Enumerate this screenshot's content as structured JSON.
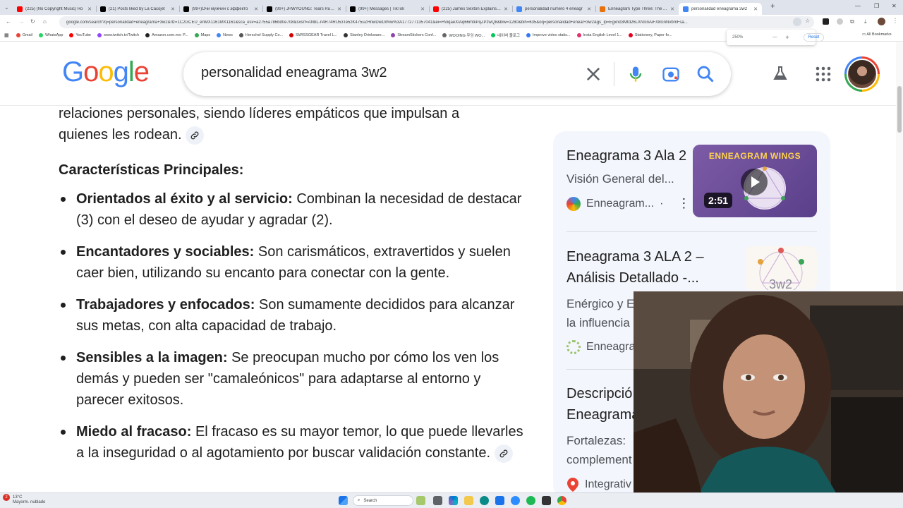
{
  "browser": {
    "tabs": [
      {
        "title": "(225) (No Copyright Music) Ro",
        "color": "#ff0000",
        "active": false
      },
      {
        "title": "(21) Posts liked by La Cacojet",
        "color": "#000000",
        "active": false
      },
      {
        "title": "(99+)Очи мужчин с эффекто",
        "color": "#000000",
        "active": false
      },
      {
        "title": "(99+) JHWYOUNG: Tears Run D",
        "color": "#000000",
        "active": false
      },
      {
        "title": "(99+) Messages | TikTok",
        "color": "#000000",
        "active": false
      },
      {
        "title": "(225) James Sexton Explains M",
        "color": "#ff0000",
        "active": false
      },
      {
        "title": "personalidad numero 4 eneagr",
        "color": "#4285f4",
        "active": false
      },
      {
        "title": "Enneagram Type Three: The Ac",
        "color": "#e8710a",
        "active": false
      },
      {
        "title": "personalidad eneagrama 3w2",
        "color": "#4285f4",
        "active": true
      }
    ],
    "new_tab": "+",
    "url": "google.com/search?q=personalidad+eneagrama+3w2&rlz=1C2GCEU_enMX1161MX1161&sca_esv=a2755a786bd0e708&sxsrf=ANbL-n4R74RU53Te5zK475uZHnwDw1Wvw%3A1772771357041&ei=HViqaeXIAq66mtkPqZPzwQ8&biw=1280&bih=635&oq=personalidad+eneat+3w2&gs_lp=Egxnd3Mtd26LXNlcnAiFX8lcnNvbmFsa...",
    "zoom_level": "250%",
    "zoom_minus": "—",
    "zoom_plus": "+",
    "zoom_reset": "Reset",
    "bookmarks": [
      {
        "label": "Gmail",
        "color": "#ea4335"
      },
      {
        "label": "WhatsApp",
        "color": "#25d366"
      },
      {
        "label": "YouTube",
        "color": "#ff0000"
      },
      {
        "label": "www.twitch.tv/Twitch",
        "color": "#9146ff"
      },
      {
        "label": "Amazon.com.mx: P...",
        "color": "#222222"
      },
      {
        "label": "Maps",
        "color": "#34a853"
      },
      {
        "label": "News",
        "color": "#4285f4"
      },
      {
        "label": "Herschel Supply Co...",
        "color": "#555555"
      },
      {
        "label": "SWISSGEAR Travel L...",
        "color": "#d50000"
      },
      {
        "label": "Stanley Drinkware...",
        "color": "#333333"
      },
      {
        "label": "StreamStickers Conf...",
        "color": "#8e44ad"
      },
      {
        "label": "WOOING 우잉 WO...",
        "color": "#666666"
      },
      {
        "label": "네이버 블로그",
        "color": "#03c75a"
      },
      {
        "label": "Improve video statis...",
        "color": "#3478f6"
      },
      {
        "label": "Insta English Level 1...",
        "color": "#e1306c"
      },
      {
        "label": "Stationery, Paper fo...",
        "color": "#e60023"
      }
    ],
    "all_bookmarks": "All Bookmarks"
  },
  "search": {
    "query": "personalidad eneagrama 3w2",
    "logo": [
      "G",
      "o",
      "o",
      "g",
      "l",
      "e"
    ],
    "logo_colors": [
      "#4285f4",
      "#ea4335",
      "#fbbc05",
      "#4285f4",
      "#34a853",
      "#ea4335"
    ]
  },
  "article": {
    "intro_line1": "relaciones personales, siendo líderes empáticos que impulsan a",
    "intro_line2": "quienes les rodean.",
    "heading": "Características Principales:",
    "items": [
      {
        "bold": "Orientados al éxito y al servicio:",
        "text": " Combinan la necesidad de destacar (3) con el deseo de ayudar y agradar (2)."
      },
      {
        "bold": "Encantadores y sociables:",
        "text": " Son carismáticos, extravertidos y suelen caer bien, utilizando su encanto para conectar con la gente."
      },
      {
        "bold": "Trabajadores y enfocados:",
        "text": " Son sumamente decididos para alcanzar sus metas, con alta capacidad de trabajo."
      },
      {
        "bold": "Sensibles a la imagen:",
        "text": " Se preocupan mucho por cómo los ven los demás y pueden ser \"camaleónicos\" para adaptarse al entorno y parecer exitosos."
      },
      {
        "bold": "Miedo al fracaso:",
        "text": " El fracaso es su mayor temor, lo que puede llevarles a la inseguridad o al agotamiento por buscar validación constante."
      }
    ]
  },
  "side": {
    "card1": {
      "title": "Eneagrama 3 Ala 2",
      "subtitle": "Visión General del...",
      "source": "Enneagram...",
      "dot": "·",
      "thumb_caption": "ENNEAGRAM WINGS",
      "duration": "2:51"
    },
    "card2": {
      "title1": "Eneagrama 3 ALA 2 –",
      "title2": "Análisis Detallado -...",
      "sub1": "Enérgico y E",
      "sub2": "la influencia",
      "source": "Enneagra",
      "thumb_caption": "3w2"
    },
    "card3": {
      "title1": "Descripció",
      "title2": "Eneagrama",
      "sub1": "Fortalezas: ",
      "sub2": "complement",
      "source": "Integrativ"
    }
  },
  "taskbar": {
    "temp": "13°C",
    "weather": "Mayorm. nublado",
    "search": "Search",
    "notif_count": "2"
  }
}
